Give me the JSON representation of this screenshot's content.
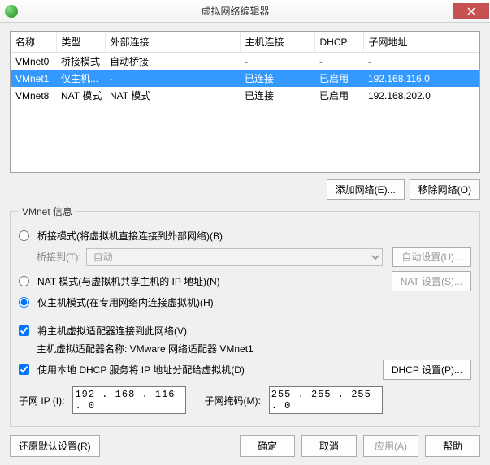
{
  "window": {
    "title": "虚拟网络编辑器"
  },
  "table": {
    "headers": [
      "名称",
      "类型",
      "外部连接",
      "主机连接",
      "DHCP",
      "子网地址"
    ],
    "rows": [
      {
        "name": "VMnet0",
        "type": "桥接模式",
        "ext": "自动桥接",
        "host": "-",
        "dhcp": "-",
        "subnet": "-",
        "selected": false
      },
      {
        "name": "VMnet1",
        "type": "仅主机...",
        "ext": "-",
        "host": "已连接",
        "dhcp": "已启用",
        "subnet": "192.168.116.0",
        "selected": true
      },
      {
        "name": "VMnet8",
        "type": "NAT 模式",
        "ext": "NAT 模式",
        "host": "已连接",
        "dhcp": "已启用",
        "subnet": "192.168.202.0",
        "selected": false
      }
    ]
  },
  "buttons": {
    "add_net": "添加网络(E)...",
    "remove_net": "移除网络(O)",
    "auto_set": "自动设置(U)...",
    "nat_set": "NAT 设置(S)...",
    "dhcp_set": "DHCP 设置(P)...",
    "restore": "还原默认设置(R)",
    "ok": "确定",
    "cancel": "取消",
    "apply": "应用(A)",
    "help": "帮助"
  },
  "info": {
    "legend": "VMnet 信息",
    "bridge_label": "桥接模式(将虚拟机直接连接到外部网络)(B)",
    "bridge_to": "桥接到(T):",
    "bridge_sel": "自动",
    "nat_label": "NAT 模式(与虚拟机共享主机的 IP 地址)(N)",
    "host_label": "仅主机模式(在专用网络内连接虚拟机)(H)",
    "connect_host": "将主机虚拟适配器连接到此网络(V)",
    "adapter_label": "主机虚拟适配器名称: VMware 网络适配器 VMnet1",
    "dhcp_label": "使用本地 DHCP 服务将 IP 地址分配给虚拟机(D)",
    "subnet_ip_label": "子网 IP (I):",
    "subnet_ip": "192 . 168 . 116 .  0",
    "subnet_mask_label": "子网掩码(M):",
    "subnet_mask": "255 . 255 . 255 .  0"
  }
}
